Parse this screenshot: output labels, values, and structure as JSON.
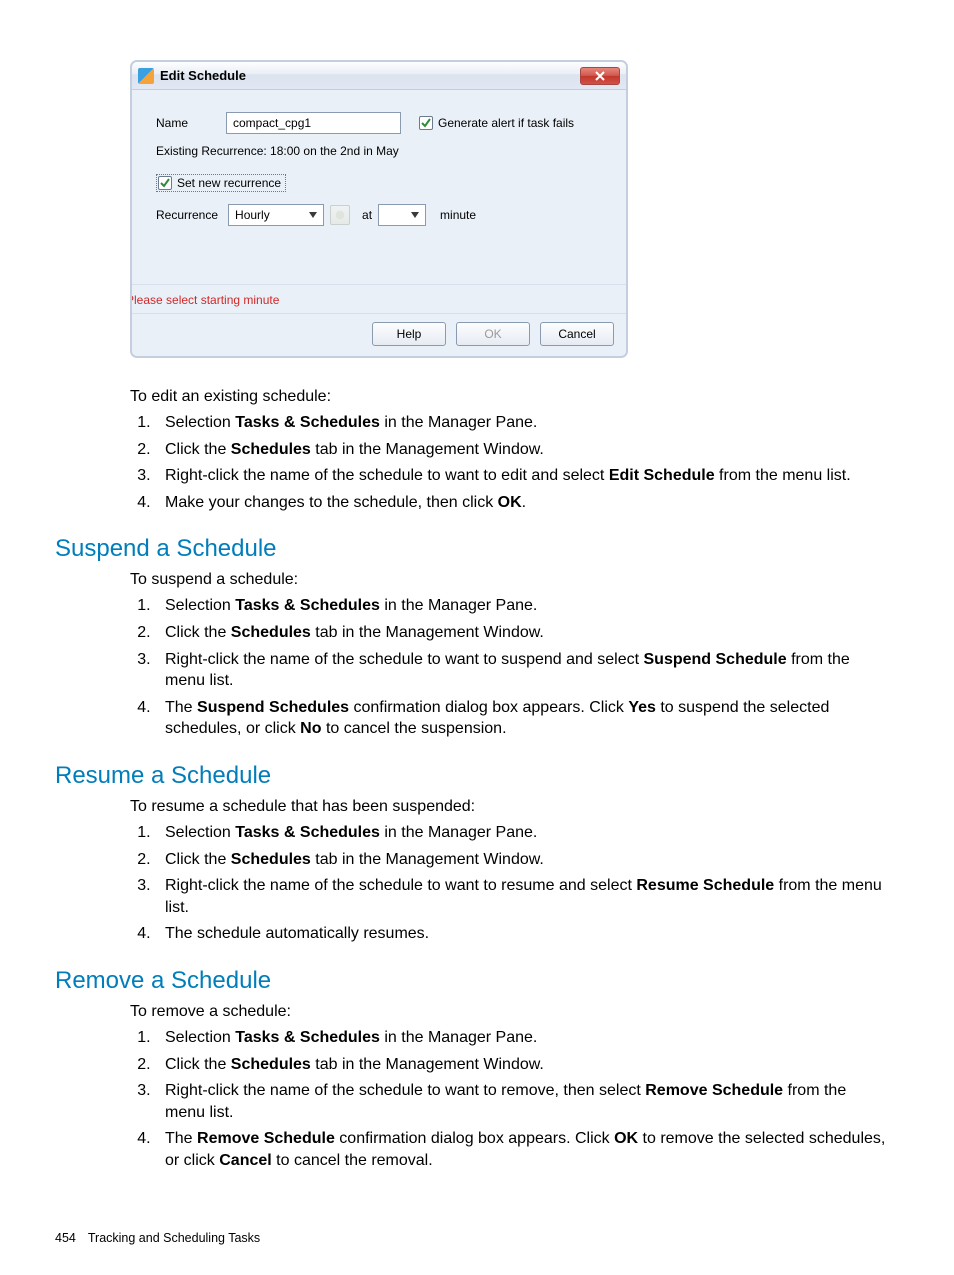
{
  "dialog": {
    "title": "Edit Schedule",
    "name_label": "Name",
    "name_value": "compact_cpg1",
    "gen_alert_label": "Generate alert if task fails",
    "existing_label": "Existing Recurrence:  18:00 on the 2nd in May",
    "set_new_label": "Set new recurrence",
    "recurrence_label": "Recurrence",
    "recurrence_value": "Hourly",
    "at_label": "at",
    "minute_value": "",
    "minute_label": "minute",
    "warning": "Please select starting minute",
    "buttons": {
      "help": "Help",
      "ok": "OK",
      "cancel": "Cancel"
    }
  },
  "edit": {
    "intro": "To edit an existing schedule:",
    "s1a": "Selection ",
    "s1b": "Tasks & Schedules",
    "s1c": " in the Manager Pane.",
    "s2a": "Click the ",
    "s2b": "Schedules",
    "s2c": " tab in the Management Window.",
    "s3a": "Right-click the name of the schedule to want to edit and select ",
    "s3b": "Edit Schedule",
    "s3c": " from the menu list.",
    "s4a": "Make your changes to the schedule, then click ",
    "s4b": "OK",
    "s4c": "."
  },
  "suspend": {
    "heading": "Suspend a Schedule",
    "intro": "To suspend a schedule:",
    "s1a": "Selection ",
    "s1b": "Tasks & Schedules",
    "s1c": " in the Manager Pane.",
    "s2a": "Click the ",
    "s2b": "Schedules",
    "s2c": " tab in the Management Window.",
    "s3a": "Right-click the name of the schedule to want to suspend and select ",
    "s3b": "Suspend Schedule",
    "s3c": " from the menu list.",
    "s4a": "The ",
    "s4b": "Suspend Schedules",
    "s4c": " confirmation dialog box appears. Click ",
    "s4d": "Yes",
    "s4e": " to suspend the selected schedules, or click ",
    "s4f": "No",
    "s4g": " to cancel the suspension."
  },
  "resume": {
    "heading": "Resume a Schedule",
    "intro": "To resume a schedule that has been suspended:",
    "s1a": "Selection ",
    "s1b": "Tasks & Schedules",
    "s1c": " in the Manager Pane.",
    "s2a": "Click the ",
    "s2b": "Schedules",
    "s2c": " tab in the Management Window.",
    "s3a": "Right-click the name of the schedule to want to resume and select ",
    "s3b": "Resume Schedule",
    "s3c": " from the menu list.",
    "s4": "The schedule automatically resumes."
  },
  "remove": {
    "heading": "Remove a Schedule",
    "intro": "To remove a schedule:",
    "s1a": "Selection ",
    "s1b": "Tasks & Schedules",
    "s1c": " in the Manager Pane.",
    "s2a": "Click the ",
    "s2b": "Schedules",
    "s2c": " tab in the Management Window.",
    "s3a": "Right-click the name of the schedule to want to remove, then select ",
    "s3b": "Remove Schedule",
    "s3c": " from the menu list.",
    "s4a": "The ",
    "s4b": "Remove Schedule",
    "s4c": " confirmation dialog box appears. Click ",
    "s4d": "OK",
    "s4e": " to remove the selected schedules, or click ",
    "s4f": "Cancel",
    "s4g": " to cancel the removal."
  },
  "footer": {
    "page": "454",
    "chapter": "Tracking and Scheduling Tasks"
  }
}
